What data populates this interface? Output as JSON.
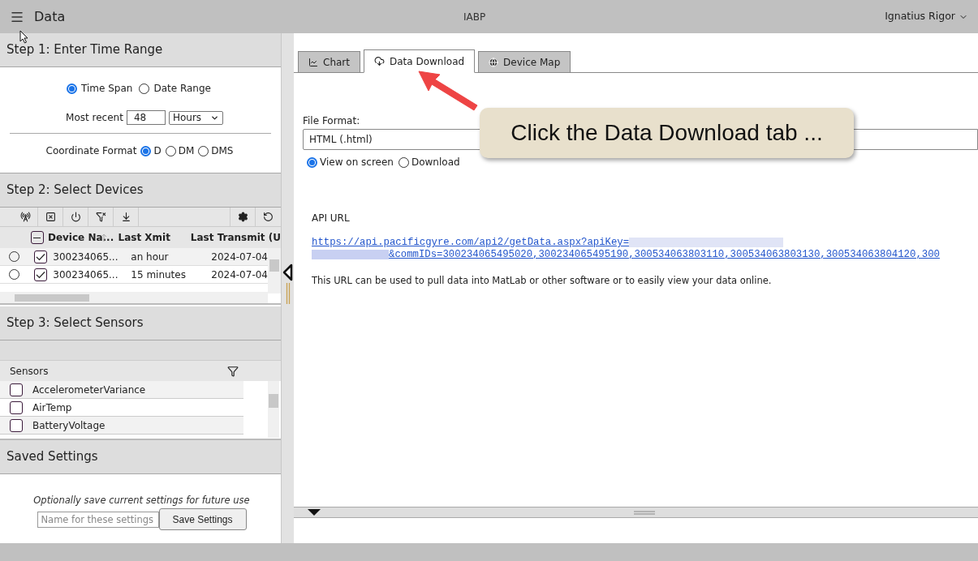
{
  "app_bar": {
    "title": "Data",
    "center": "IABP",
    "user": "Ignatius Rigor"
  },
  "step1": {
    "title": "Step 1: Enter Time Range",
    "mode_options": [
      {
        "label": "Time Span",
        "selected": true
      },
      {
        "label": "Date Range",
        "selected": false
      }
    ],
    "recent_label": "Most recent",
    "recent_value": "48",
    "recent_unit": "Hours",
    "coordinate_label": "Coordinate Format",
    "coordinate_options": [
      {
        "label": "D",
        "selected": true
      },
      {
        "label": "DM",
        "selected": false
      },
      {
        "label": "DMS",
        "selected": false
      }
    ]
  },
  "step2": {
    "title": "Step 2: Select Devices",
    "header_checkbox_indeterminate": true,
    "columns": [
      "Device Na...",
      "Last Xmit",
      "Last Transmit (U"
    ],
    "rows": [
      {
        "selected": false,
        "checked": true,
        "cells": [
          "300234065...",
          "an hour",
          "2024-07-04"
        ]
      },
      {
        "selected": false,
        "checked": true,
        "cells": [
          "300234065...",
          "15 minutes",
          "2024-07-04"
        ]
      }
    ]
  },
  "step3": {
    "title": "Step 3: Select Sensors",
    "header": "Sensors",
    "sensors": [
      {
        "name": "AccelerometerVariance",
        "checked": false
      },
      {
        "name": "AirTemp",
        "checked": false
      },
      {
        "name": "BatteryVoltage",
        "checked": false
      }
    ]
  },
  "saved": {
    "title": "Saved Settings",
    "hint": "Optionally save current settings for future use",
    "placeholder": "Name for these settings",
    "button": "Save Settings"
  },
  "tabs": [
    {
      "label": "Chart",
      "kind": "chart",
      "selected": false
    },
    {
      "label": "Data Download",
      "kind": "download",
      "selected": true
    },
    {
      "label": "Device Map",
      "kind": "map",
      "selected": false
    }
  ],
  "download": {
    "format_label": "File Format:",
    "format_value": "HTML (.html)",
    "output_options": [
      {
        "label": "View on screen",
        "selected": true
      },
      {
        "label": "Download",
        "selected": false
      }
    ],
    "api_label": "API URL",
    "api_url_parts": [
      "https://api.pacificgyre.com/api2/getData.aspx?apiKey=",
      "&commIDs=300234065495020,300234065495190,300534063803110,300534063803130,300534063804120,300"
    ],
    "note": "This URL can be used to pull data into MatLab or other software or to easily view your data online."
  },
  "callout": {
    "text": "Click the Data Download tab ..."
  }
}
